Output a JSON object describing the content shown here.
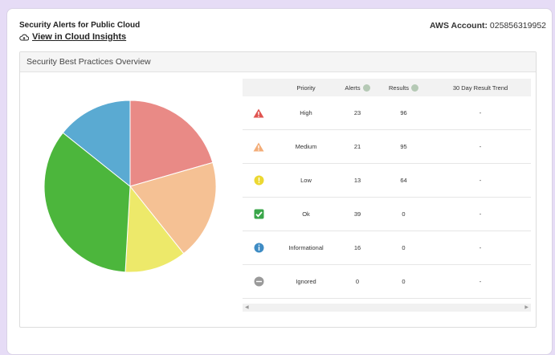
{
  "header": {
    "title": "Security Alerts for Public Cloud",
    "link": "View in Cloud Insights",
    "account_label": "AWS Account:",
    "account_id": "025856319952"
  },
  "panel": {
    "title": "Security Best Practices Overview"
  },
  "table": {
    "headers": {
      "priority": "Priority",
      "alerts": "Alerts",
      "results": "Results",
      "trend": "30 Day Result Trend"
    },
    "rows": [
      {
        "priority": "High",
        "alerts": "23",
        "results": "96",
        "trend": "-",
        "icon": "warning-triangle-red-icon"
      },
      {
        "priority": "Medium",
        "alerts": "21",
        "results": "95",
        "trend": "-",
        "icon": "warning-triangle-orange-icon"
      },
      {
        "priority": "Low",
        "alerts": "13",
        "results": "64",
        "trend": "-",
        "icon": "exclamation-circle-yellow-icon"
      },
      {
        "priority": "Ok",
        "alerts": "39",
        "results": "0",
        "trend": "-",
        "icon": "check-square-green-icon"
      },
      {
        "priority": "Informational",
        "alerts": "16",
        "results": "0",
        "trend": "-",
        "icon": "info-circle-blue-icon"
      },
      {
        "priority": "Ignored",
        "alerts": "0",
        "results": "0",
        "trend": "-",
        "icon": "minus-circle-gray-icon"
      }
    ]
  },
  "colors": {
    "high": "#e98a86",
    "medium": "#f5c194",
    "low": "#ede96a",
    "ok": "#4cb63c",
    "informational": "#5aaad2",
    "ignored": "#9a9a9a"
  },
  "chart_data": {
    "type": "pie",
    "categories": [
      "High",
      "Medium",
      "Low",
      "Ok",
      "Informational",
      "Ignored"
    ],
    "values": [
      23,
      21,
      13,
      39,
      16,
      0
    ]
  }
}
